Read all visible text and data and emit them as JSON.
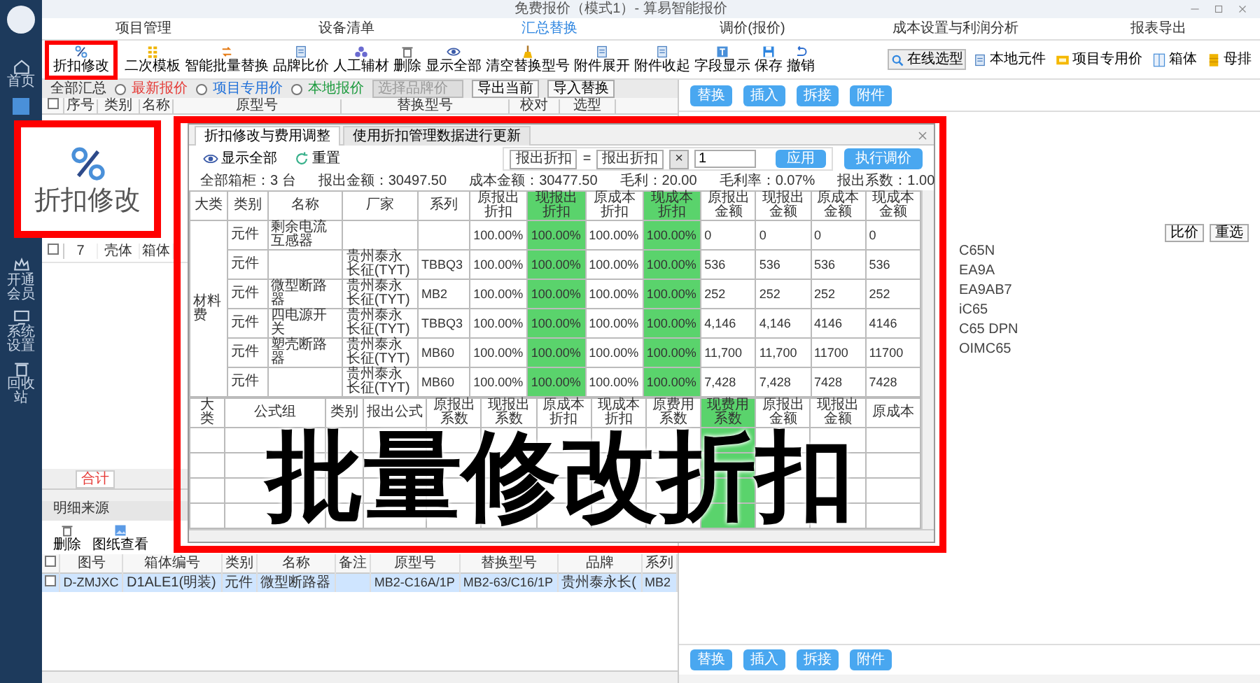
{
  "window": {
    "title": "免费报价（模式1）- 算易智能报价"
  },
  "sidebar": {
    "items": [
      {
        "label": "首页"
      },
      {
        "label": "开通会员"
      },
      {
        "label": "系统设置"
      },
      {
        "label": "回收站"
      }
    ]
  },
  "menu": [
    {
      "label": "项目管理",
      "selected": false
    },
    {
      "label": "设备清单",
      "selected": false
    },
    {
      "label": "汇总替换",
      "selected": true
    },
    {
      "label": "调价(报价)",
      "selected": false
    },
    {
      "label": "成本设置与利润分析",
      "selected": false
    },
    {
      "label": "报表导出",
      "selected": false
    }
  ],
  "toolbar": {
    "left": [
      "折扣修改",
      "二次模板",
      "智能批量替换",
      "品牌比价",
      "人工辅材",
      "删除",
      "显示全部",
      "清空替换型号",
      "附件展开",
      "附件收起",
      "字段显示",
      "保存",
      "撤销"
    ],
    "right": [
      "在线选型",
      "本地元件",
      "项目专用价",
      "箱体",
      "母排"
    ]
  },
  "filter": {
    "label": "全部汇总",
    "radios": [
      {
        "label": "最新报价",
        "selected": false,
        "color": "#e53935"
      },
      {
        "label": "项目专用价",
        "selected": false,
        "color": "#1e6fd9"
      },
      {
        "label": "本地报价",
        "selected": false,
        "color": "#1a9a3c"
      }
    ],
    "select_placeholder": "选择品牌价",
    "buttons": [
      "导出当前",
      "导入替换"
    ]
  },
  "main_table": {
    "header_checked": false,
    "columns": [
      "序号",
      "类别",
      "名称",
      "原型号",
      "替换型号",
      "校对",
      "选型"
    ],
    "rows": [
      {
        "checked": false,
        "cells": [
          "7",
          "壳体",
          "箱体"
        ]
      }
    ],
    "total": "合计"
  },
  "right_panel": {
    "buttons": [
      "替换",
      "插入",
      "拆接",
      "附件"
    ],
    "actions": [
      "比价",
      "重选"
    ],
    "items": [
      "C65N",
      "EA9A",
      "EA9AB7",
      "iC65",
      "C65 DPN",
      "OIMC65"
    ],
    "bottom_buttons": [
      "替换",
      "插入",
      "拆接",
      "附件"
    ]
  },
  "detail": {
    "title": "明细来源",
    "tools": [
      "删除",
      "图纸查看"
    ],
    "header_checked": false,
    "columns": [
      "图号",
      "箱体编号",
      "类别",
      "名称",
      "备注",
      "原型号",
      "替换型号",
      "品牌",
      "系列"
    ],
    "rows": [
      {
        "checked": false,
        "selected": true,
        "cells": [
          "D-ZMJXC",
          "D1ALE1(明装)",
          "元件",
          "微型断路器",
          "",
          "MB2-C16A/1P",
          "MB2-63/C16/1P",
          "贵州泰永长(",
          "MB2"
        ]
      }
    ]
  },
  "dialog": {
    "tabs": [
      {
        "label": "折扣修改与费用调整",
        "selected": true
      },
      {
        "label": "使用折扣管理数据进行更新",
        "selected": false
      }
    ],
    "tools": [
      "显示全部",
      "重置"
    ],
    "formula": {
      "target": "报出折扣",
      "sign": "=",
      "source": "报出折扣",
      "operator": "×",
      "value": "1"
    },
    "apply": "应用",
    "execute": "执行调价",
    "summary": [
      "全部箱柜：3 台",
      "报出金额：30497.50",
      "成本金额：30477.50",
      "毛利：20.00",
      "毛利率：0.07%",
      "报出系数：1.00"
    ],
    "table1": {
      "columns": [
        {
          "label": "大类",
          "highlighted": false
        },
        {
          "label": "类别",
          "highlighted": false
        },
        {
          "label": "名称",
          "highlighted": false
        },
        {
          "label": "厂家",
          "highlighted": false
        },
        {
          "label": "系列",
          "highlighted": false
        },
        {
          "label": "原报出折扣",
          "highlighted": false
        },
        {
          "label": "现报出折扣",
          "highlighted": true
        },
        {
          "label": "原成本折扣",
          "highlighted": false
        },
        {
          "label": "现成本折扣",
          "highlighted": true
        },
        {
          "label": "原报出金额",
          "highlighted": false
        },
        {
          "label": "现报出金额",
          "highlighted": false
        },
        {
          "label": "原成本金额",
          "highlighted": false
        },
        {
          "label": "现成本金额",
          "highlighted": false
        }
      ],
      "rows": [
        {
          "cells": [
            {
              "text": "材料费",
              "rowspan": 6
            },
            "元件",
            "剩余电流互感器",
            "",
            "",
            "100.00%",
            "100.00%",
            "100.00%",
            "100.00%",
            "0",
            "0",
            "0",
            "0"
          ]
        },
        {
          "cells": [
            "元件",
            "",
            "贵州泰永长征(TYT)",
            "TBBQ3",
            "100.00%",
            "100.00%",
            "100.00%",
            "100.00%",
            "536",
            "536",
            "536",
            "536"
          ]
        },
        {
          "cells": [
            "元件",
            "微型断路器",
            "贵州泰永长征(TYT)",
            "MB2",
            "100.00%",
            "100.00%",
            "100.00%",
            "100.00%",
            "252",
            "252",
            "252",
            "252"
          ]
        },
        {
          "cells": [
            "元件",
            "四电源开关",
            "贵州泰永长征(TYT)",
            "TBBQ3",
            "100.00%",
            "100.00%",
            "100.00%",
            "100.00%",
            "4,146",
            "4,146",
            "4146",
            "4146"
          ]
        },
        {
          "cells": [
            "元件",
            "塑壳断路器",
            "贵州泰永长征(TYT)",
            "MB60",
            "100.00%",
            "100.00%",
            "100.00%",
            "100.00%",
            "11,700",
            "11,700",
            "11700",
            "11700"
          ]
        },
        {
          "cells": [
            "元件",
            "",
            "贵州泰永长征(TYT)",
            "MB60",
            "100.00%",
            "100.00%",
            "100.00%",
            "100.00%",
            "7,428",
            "7,428",
            "7428",
            "7428"
          ]
        }
      ]
    },
    "table2": {
      "columns": [
        {
          "label": "大类",
          "highlighted": false
        },
        {
          "label": "公式组",
          "highlighted": false
        },
        {
          "label": "类别",
          "highlighted": false
        },
        {
          "label": "报出公式",
          "highlighted": false
        },
        {
          "label": "原报出系数",
          "highlighted": false
        },
        {
          "label": "现报出系数",
          "highlighted": false
        },
        {
          "label": "原成本折扣",
          "highlighted": false
        },
        {
          "label": "现成本折扣",
          "highlighted": false
        },
        {
          "label": "原费用系数",
          "highlighted": false
        },
        {
          "label": "现费用系数",
          "highlighted": true
        },
        {
          "label": "原报出金额",
          "highlighted": false
        },
        {
          "label": "现报出金额",
          "highlighted": false
        },
        {
          "label": "原成本",
          "highlighted": false
        }
      ]
    }
  },
  "callout": {
    "label": "折扣修改"
  },
  "caption": "批量修改折扣"
}
